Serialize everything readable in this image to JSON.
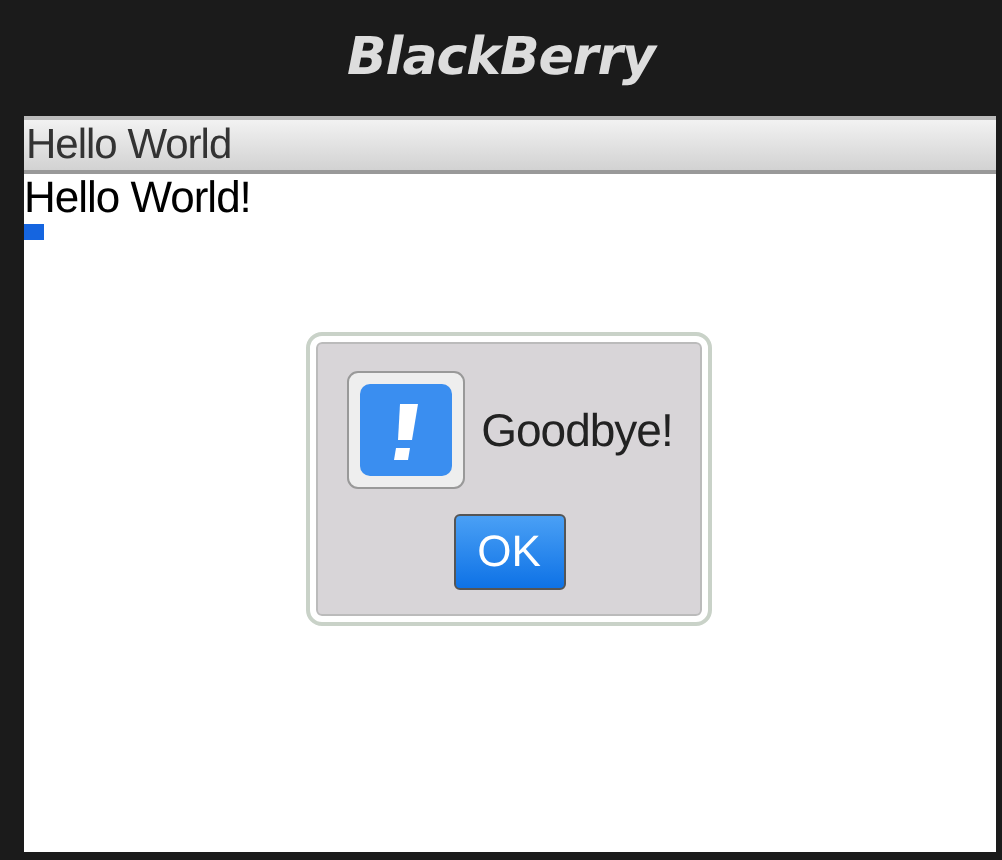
{
  "device": {
    "brand": "BlackBerry"
  },
  "screen": {
    "title": "Hello World",
    "content": "Hello World!"
  },
  "dialog": {
    "message": "Goodbye!",
    "buttons": [
      {
        "label": "OK",
        "focused": true
      }
    ]
  }
}
